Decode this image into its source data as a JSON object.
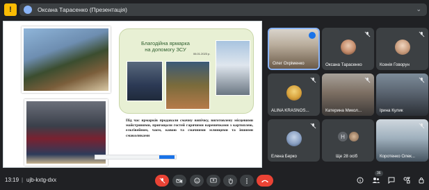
{
  "header": {
    "presenter_label": "Оксана Тарасенко (Презентація)"
  },
  "slide": {
    "banner_title": "Благодійна ярмарка на допомогу ЗСУ",
    "banner_date": "06.01.2023 р.",
    "caption": "Під час ярмарків продавали смачну випічку, виготовлену місцевими майстринями, пригощали гостей гарячими вареничками з картоплею, ельтівейном, чаєм, кавою та смачними млинцями та іншими смаколиками"
  },
  "participants": [
    {
      "name": "Олег Охріменко",
      "state": "active"
    },
    {
      "name": "Оксана Тарасенко",
      "state": "muted"
    },
    {
      "name": "Ксенія Говорун",
      "state": "muted"
    },
    {
      "name": "ALINA KRASNOS...",
      "state": "muted"
    },
    {
      "name": "Катерина Микол...",
      "state": "muted"
    },
    {
      "name": "Ірина Кулик",
      "state": "muted"
    },
    {
      "name": "Елена Берко",
      "state": "muted"
    },
    {
      "name": "Ще 28 осіб",
      "state": "more",
      "initial": "Н"
    },
    {
      "name": "Коротенко Олек...",
      "state": "muted"
    }
  ],
  "bottom": {
    "time": "13:19",
    "separator": "|",
    "meeting_code": "ujb-kxtg-dxx",
    "participant_count": "36"
  },
  "colors": {
    "background": "#202124",
    "tile": "#3c4043",
    "accent": "#8ab4f8",
    "danger": "#ea4335"
  }
}
